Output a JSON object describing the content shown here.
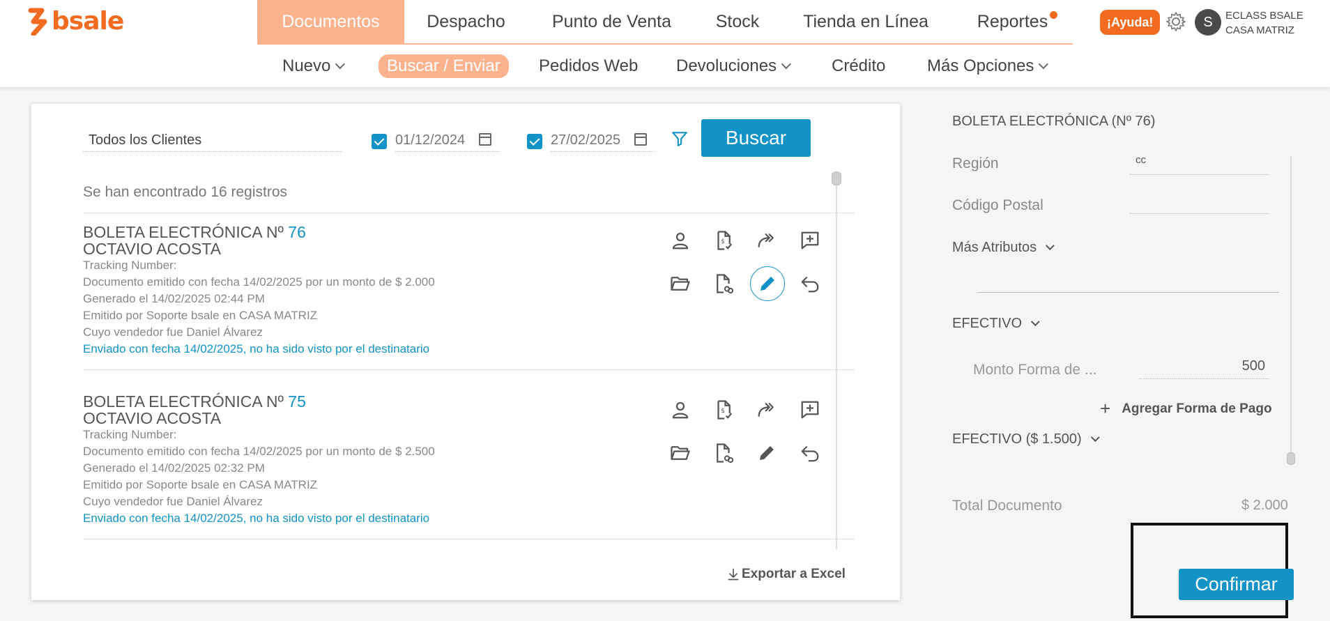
{
  "brand": {
    "name": "bsale",
    "color": "#f26b21"
  },
  "main_nav": [
    {
      "label": "Documentos",
      "active": true
    },
    {
      "label": "Despacho"
    },
    {
      "label": "Punto de Venta"
    },
    {
      "label": "Stock"
    },
    {
      "label": "Tienda en Línea"
    },
    {
      "label": "Reportes",
      "has_dot": true
    }
  ],
  "header": {
    "help_label": "¡Ayuda!",
    "avatar_initial": "S",
    "account_line1": "ECLASS BSALE",
    "account_line2": "CASA MATRIZ"
  },
  "sub_nav": [
    {
      "label": "Nuevo",
      "dropdown": true
    },
    {
      "label": "Buscar / Enviar",
      "active": true
    },
    {
      "label": "Pedidos Web"
    },
    {
      "label": "Devoluciones",
      "dropdown": true
    },
    {
      "label": "Crédito"
    },
    {
      "label": "Más Opciones",
      "dropdown": true
    }
  ],
  "search": {
    "client": "Todos los Clientes",
    "date_from": "01/12/2024",
    "date_from_checked": true,
    "date_to": "27/02/2025",
    "date_to_checked": true,
    "button_label": "Buscar"
  },
  "results_count_text": "Se han encontrado 16 registros",
  "records": [
    {
      "title_prefix": "BOLETA ELECTRÓNICA Nº",
      "number": "76",
      "client": "OCTAVIO ACOSTA",
      "tracking": "Tracking Number:",
      "issued": "Documento emitido con fecha 14/02/2025 por un monto de $ 2.000",
      "generated": "Generado el 14/02/2025 02:44 PM",
      "emitted_by": "Emitido por Soporte bsale en CASA MATRIZ",
      "seller": "Cuyo vendedor fue Daniel Álvarez",
      "sent": "Enviado con fecha 14/02/2025, no ha sido visto por el destinatario",
      "edit_selected": true
    },
    {
      "title_prefix": "BOLETA ELECTRÓNICA Nº",
      "number": "75",
      "client": "OCTAVIO ACOSTA",
      "tracking": "Tracking Number:",
      "issued": "Documento emitido con fecha 14/02/2025 por un monto de $ 2.500",
      "generated": "Generado el 14/02/2025 02:32 PM",
      "emitted_by": "Emitido por Soporte bsale en CASA MATRIZ",
      "seller": "Cuyo vendedor fue Daniel Álvarez",
      "sent": "Enviado con fecha 14/02/2025, no ha sido visto por el destinatario",
      "edit_selected": false
    }
  ],
  "export_label": "Exportar a Excel",
  "detail": {
    "title": "BOLETA ELECTRÓNICA (Nº 76)",
    "region_label": "Región",
    "region_value": "cc",
    "postal_label": "Código Postal",
    "postal_value": "",
    "more_attrs_label": "Más Atributos",
    "payment_section": "EFECTIVO",
    "amount_label": "Monto Forma de ...",
    "amount_value": "500",
    "add_payment_label": "Agregar Forma de Pago",
    "payment_summary": "EFECTIVO ($ 1.500)",
    "total_label": "Total Documento",
    "total_value": "$ 2.000",
    "confirm_label": "Confirmar"
  },
  "colors": {
    "accent": "#1193c7",
    "nav_active": "#fcb38d",
    "brand": "#f26b21"
  }
}
